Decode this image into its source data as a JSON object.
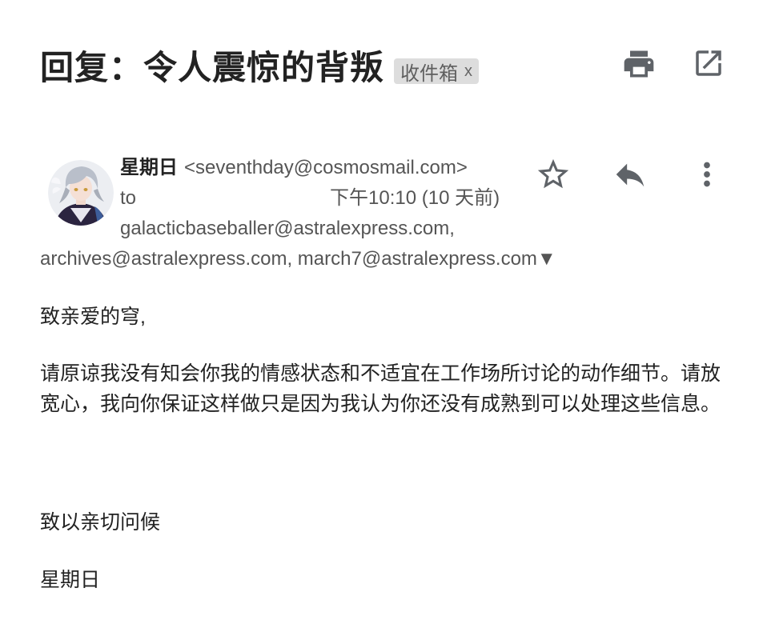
{
  "subject": {
    "title": "回复：令人震惊的背叛",
    "label": "收件箱",
    "label_remove": "x"
  },
  "toolbar": {
    "print_icon": "print-icon",
    "open_new_window_icon": "open-in-new-icon"
  },
  "message": {
    "sender_name": "星期日",
    "sender_email": "<seventhday@cosmosmail.com>",
    "to_label": "to",
    "date": "下午10:10 (10 天前)",
    "recipients_line1": "galacticbaseballer@astralexpress.com,",
    "recipients_line2": "archives@astralexpress.com, march7@astralexpress.com",
    "expand_symbol": "▼",
    "actions": {
      "star_icon": "star-outline-icon",
      "reply_icon": "reply-icon",
      "more_icon": "more-vertical-icon"
    }
  },
  "body": {
    "greeting": "致亲爱的穹,",
    "paragraph": "请原谅我没有知会你我的情感状态和不适宜在工作场所讨论的动作细节。请放宽心，我向你保证这样做只是因为我认为你还没有成熟到可以处理这些信息。",
    "closing": "致以亲切问候",
    "signature": "星期日"
  },
  "colors": {
    "chip_bg": "#dddddd",
    "icon_gray": "#5f6368",
    "text_dark": "#222222",
    "text_muted": "#555555"
  }
}
